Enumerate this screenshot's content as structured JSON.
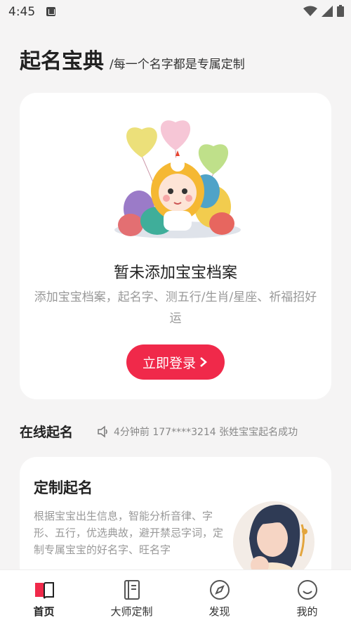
{
  "status": {
    "time": "4:45"
  },
  "header": {
    "title": "起名宝典",
    "subtitle": "/每一个名字都是专属定制"
  },
  "profile_card": {
    "empty_title": "暂未添加宝宝档案",
    "empty_desc": "添加宝宝档案，起名字、测五行/生肖/星座、祈福招好运",
    "login_label": "立即登录"
  },
  "online": {
    "title": "在线起名",
    "ticker": "4分钟前 177****3214 张姓宝宝起名成功"
  },
  "custom_card": {
    "title": "定制起名",
    "desc": "根据宝宝出生信息，智能分析音律、字形、五行，优选典故，避开禁忌字词，定制专属宝宝的好名字、旺名字"
  },
  "tabs": [
    {
      "label": "首页",
      "icon": "book-icon",
      "active": true
    },
    {
      "label": "大师定制",
      "icon": "notebook-icon",
      "active": false
    },
    {
      "label": "发现",
      "icon": "compass-icon",
      "active": false
    },
    {
      "label": "我的",
      "icon": "smile-icon",
      "active": false
    }
  ],
  "colors": {
    "accent": "#f0294a",
    "background": "#f5f4f4"
  }
}
